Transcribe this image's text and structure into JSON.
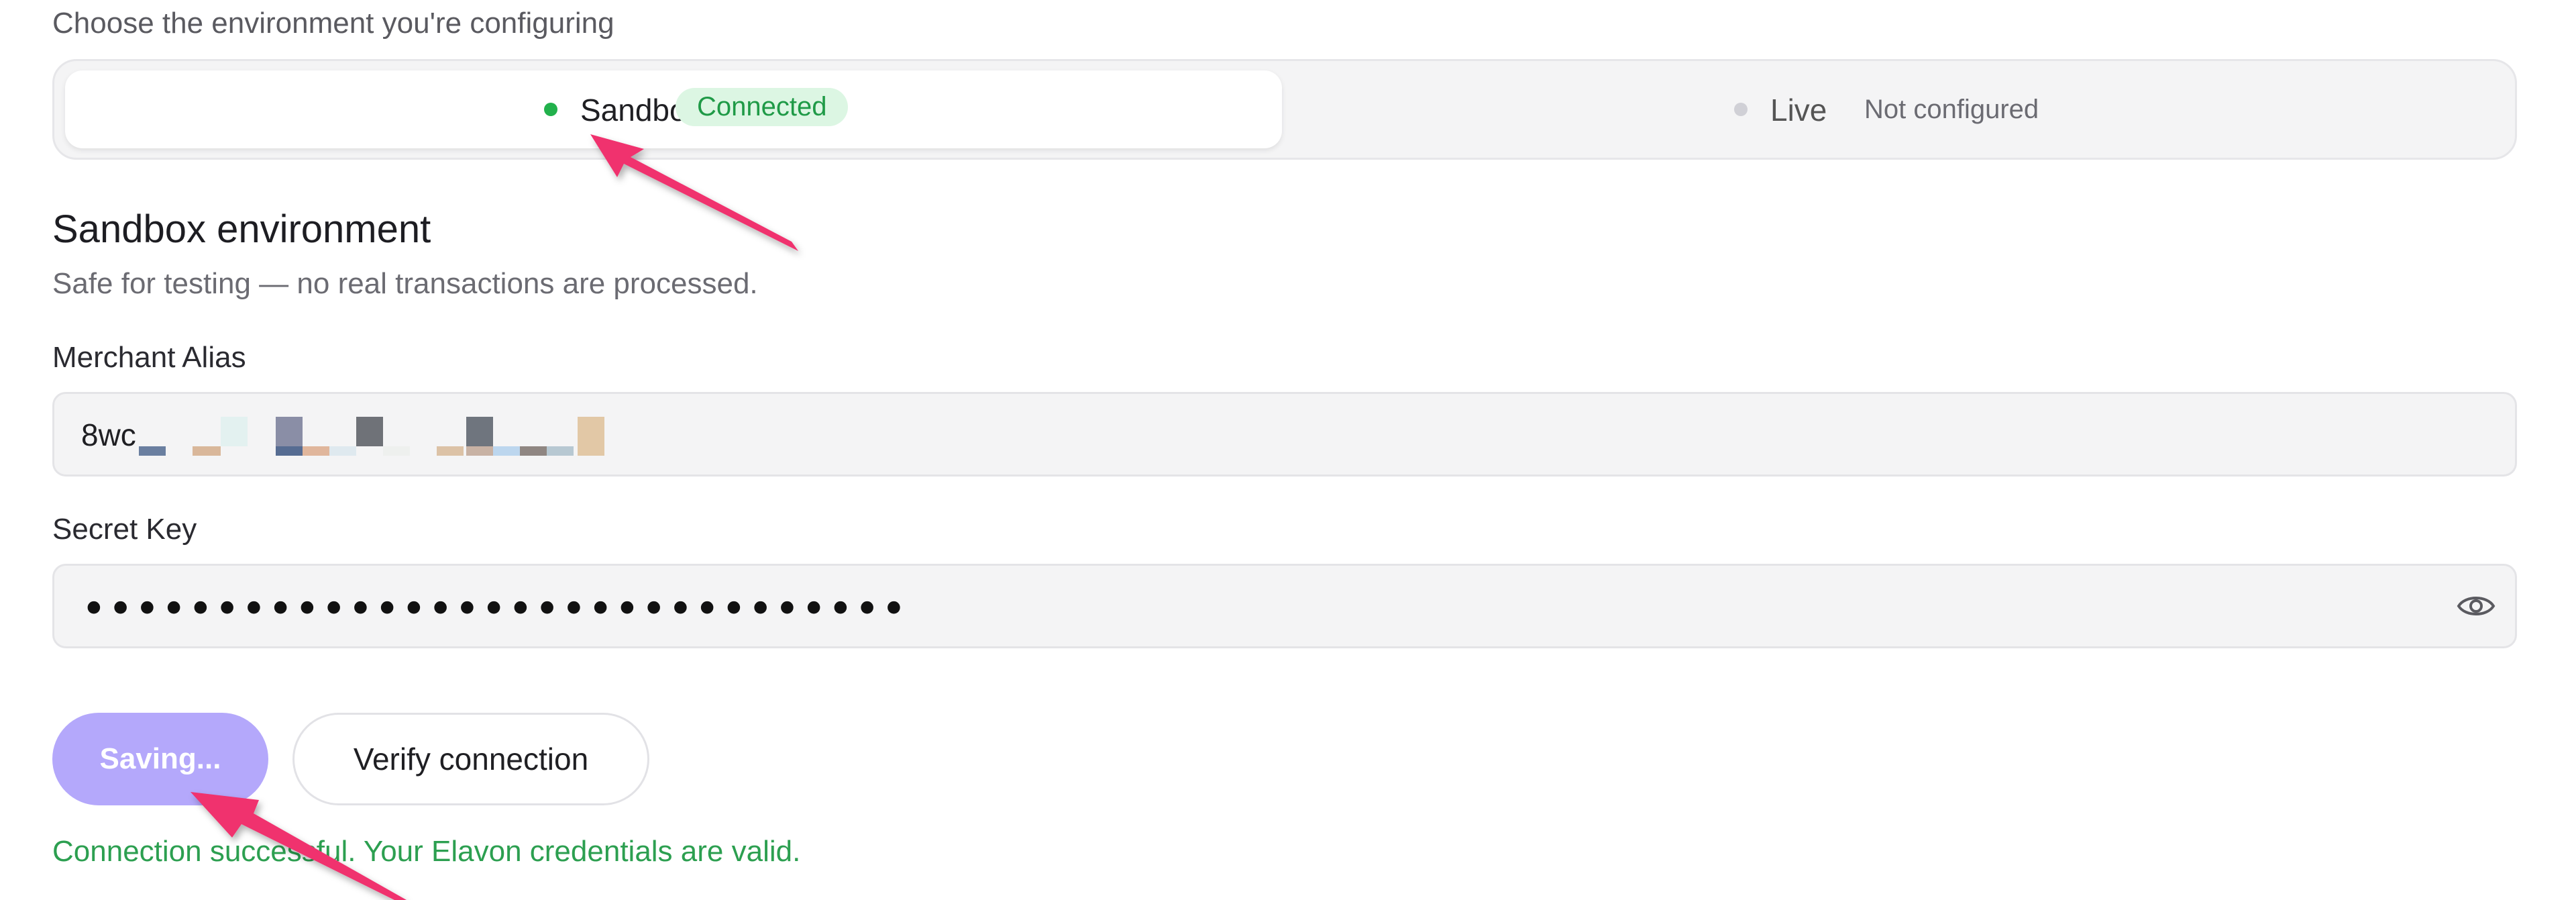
{
  "header": {
    "prompt": "Choose the environment you're configuring"
  },
  "environments": [
    {
      "label": "Sandbox",
      "status": "Connected",
      "active": true,
      "dot_color": "#22b14c"
    },
    {
      "label": "Live",
      "status": "Not configured",
      "active": false,
      "dot_color": "#d0d0d6"
    }
  ],
  "section": {
    "title": "Sandbox environment",
    "subtitle": "Safe for testing — no real transactions are processed."
  },
  "fields": {
    "merchant_alias": {
      "label": "Merchant Alias",
      "value_prefix": "8wc"
    },
    "secret_key": {
      "label": "Secret Key",
      "masked_value": "•••••••••••••••••••••••••••••••"
    }
  },
  "actions": {
    "save_label": "Saving...",
    "verify_label": "Verify connection"
  },
  "status_message": "Connection successful. Your Elavon credentials are valid.",
  "colors": {
    "accent": "#b4a8fb",
    "success": "#2c9f50",
    "annotation": "#f0306e"
  }
}
